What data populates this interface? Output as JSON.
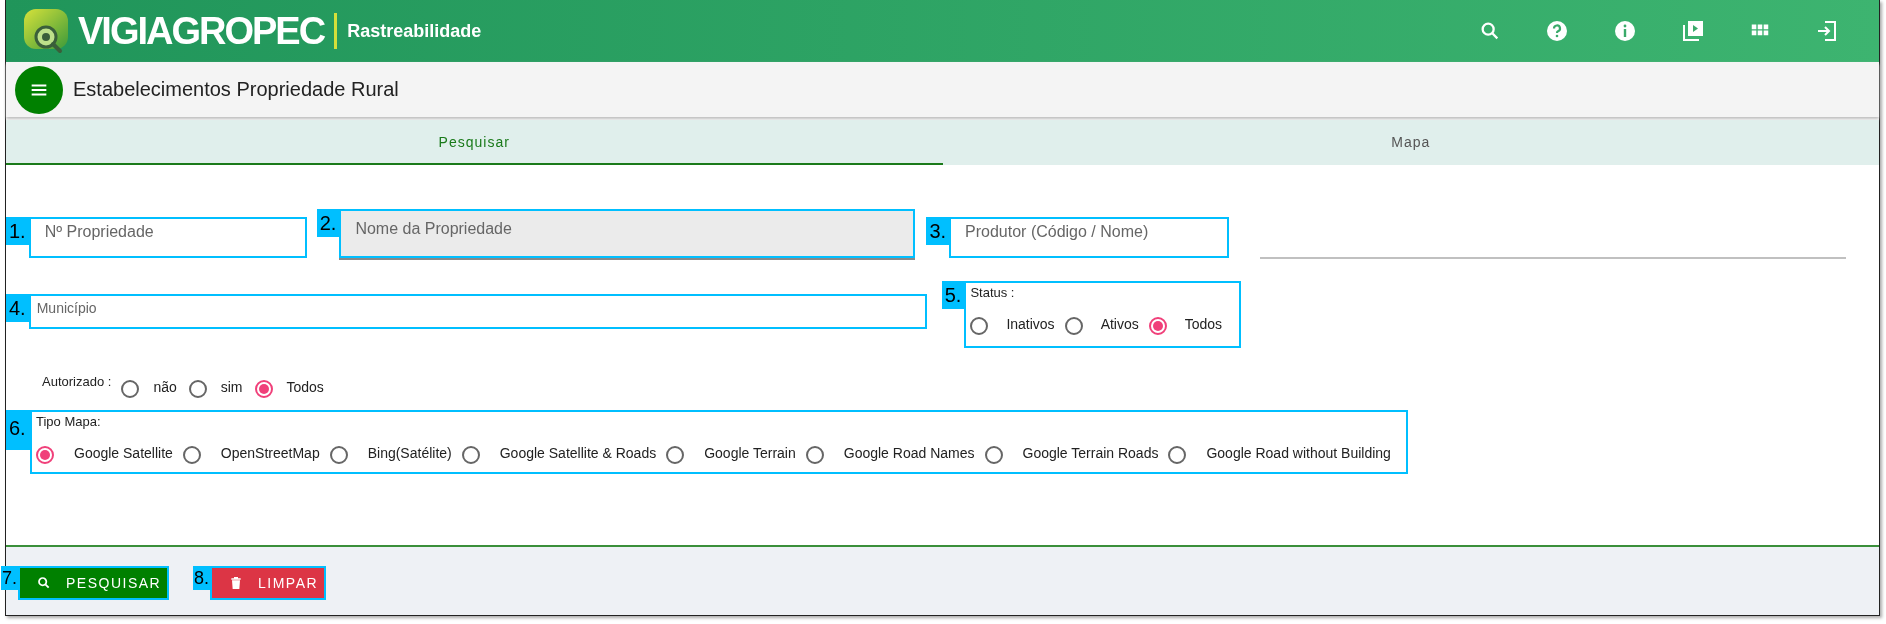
{
  "header": {
    "brand": "VIGIAGROPEC",
    "subtitle": "Rastreabilidade"
  },
  "page_title": "Estabelecimentos Propriedade Rural",
  "tabs": [
    {
      "label": "Pesquisar",
      "selected": true
    },
    {
      "label": "Mapa",
      "selected": false
    }
  ],
  "fields": [
    {
      "callout": "1.",
      "placeholder": "Nº Propriedade",
      "kind": "outlined"
    },
    {
      "callout": "2.",
      "placeholder": "Nome da Propriedade",
      "kind": "filled"
    },
    {
      "callout": "3.",
      "placeholder": "Produtor (Código / Nome)",
      "kind": "outlined"
    }
  ],
  "municipality": {
    "callout": "4.",
    "placeholder": "Município"
  },
  "status": {
    "callout": "5.",
    "label": "Status :",
    "options": [
      {
        "label": "Inativos",
        "selected": false
      },
      {
        "label": "Ativos",
        "selected": false
      },
      {
        "label": "Todos",
        "selected": true
      }
    ]
  },
  "authorized": {
    "label": "Autorizado :",
    "options": [
      {
        "label": "não",
        "selected": false
      },
      {
        "label": "sim",
        "selected": false
      },
      {
        "label": "Todos",
        "selected": true
      }
    ]
  },
  "map_type": {
    "callout": "6.",
    "label": "Tipo Mapa:",
    "options": [
      {
        "label": "Google Satellite",
        "selected": true
      },
      {
        "label": "OpenStreetMap",
        "selected": false
      },
      {
        "label": "Bing(Satélite)",
        "selected": false
      },
      {
        "label": "Google Satellite & Roads",
        "selected": false
      },
      {
        "label": "Google Terrain",
        "selected": false
      },
      {
        "label": "Google Road Names",
        "selected": false
      },
      {
        "label": "Google Terrain Roads",
        "selected": false
      },
      {
        "label": "Google Road without Building",
        "selected": false
      }
    ]
  },
  "buttons": [
    {
      "callout": "7.",
      "label": "PESQUISAR",
      "kind": "search"
    },
    {
      "callout": "8.",
      "label": "LIMPAR",
      "kind": "clear"
    }
  ]
}
